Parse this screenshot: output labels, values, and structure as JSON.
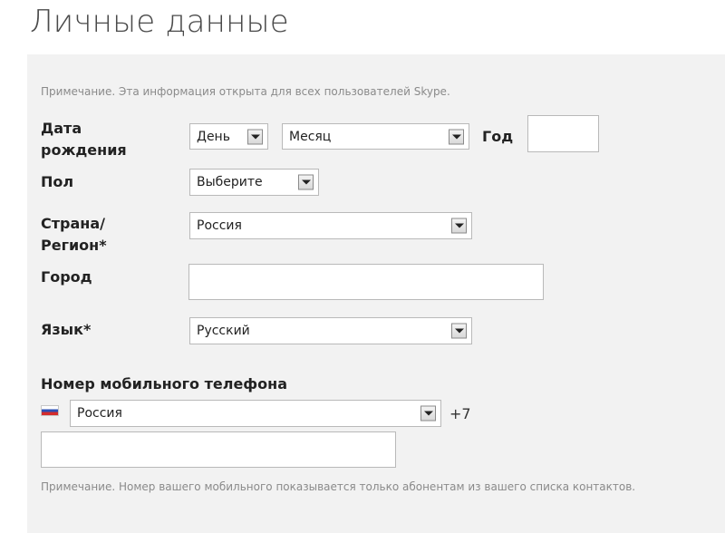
{
  "page_title": "Личные данные",
  "note_top": "Примечание. Эта информация открыта для всех пользователей Skype.",
  "birth": {
    "label_line1": "Дата",
    "label_line2": "рождения",
    "day": "День",
    "month": "Месяц",
    "year_label": "Год",
    "year_value": ""
  },
  "gender": {
    "label": "Пол",
    "value": "Выберите"
  },
  "country": {
    "label_line1": "Страна/",
    "label_line2": "Регион*",
    "value": "Россия"
  },
  "city": {
    "label": "Город",
    "value": ""
  },
  "language": {
    "label": "Язык*",
    "value": "Русский"
  },
  "mobile": {
    "label": "Номер мобильного телефона",
    "country_value": "Россия",
    "country_code": "+7",
    "number_value": "",
    "flag_icon": "russia-flag-icon"
  },
  "note_bottom": "Примечание. Номер вашего мобильного показывается только абонентам из вашего списка контактов.",
  "colors": {
    "panel_bg": "#f2f2f2",
    "note": "#8a8a8a"
  }
}
